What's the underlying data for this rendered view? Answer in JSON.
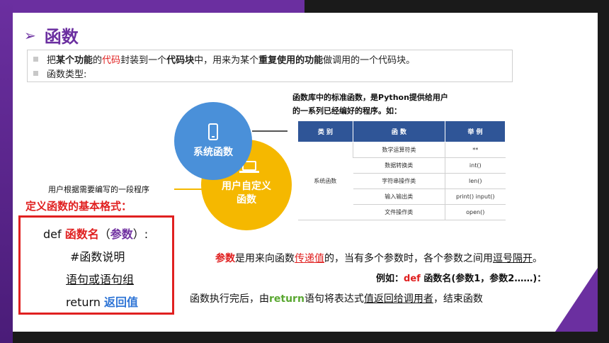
{
  "title": "函数",
  "bullets": {
    "line1": {
      "p1": "把",
      "p2": "某个功能",
      "p3": "的",
      "p4": "代码",
      "p5": "封装到一个",
      "p6": "代码块",
      "p7": "中，用来为某个",
      "p8": "重复使用的功能",
      "p9": "做调用的一个代码块。"
    },
    "line2": "函数类型:"
  },
  "library_description": {
    "line1": "函数库中的标准函数，是Python提供给用户",
    "line2": "的一系列已经编好的程序。如："
  },
  "circles": {
    "system": "系统函数",
    "user_line1": "用户自定义",
    "user_line2": "函数"
  },
  "user_description": "用户根据需要编写的一段程序",
  "table": {
    "headers": [
      "类 别",
      "函 数",
      "举 例"
    ],
    "category": "系统函数",
    "rows": [
      {
        "func": "数学运算符类",
        "example": "**"
      },
      {
        "func": "数据转换类",
        "example": "int()"
      },
      {
        "func": "字符串操作类",
        "example": "len()"
      },
      {
        "func": "输入输出类",
        "example": "print()  input()"
      },
      {
        "func": "文件操作类",
        "example": "open()"
      }
    ]
  },
  "definition": {
    "title": "定义函数的基本格式：",
    "def_kw": "def ",
    "func_name": "函数名",
    "paren_open": "（",
    "params": "参数",
    "paren_close": "）:",
    "comment": "#函数说明",
    "statements": "语句或语句组",
    "return_kw": "return ",
    "return_value": "返回值"
  },
  "param_explanation": {
    "p1": "参数",
    "p2": "是用来向函数",
    "p3": "传递值",
    "p4": "的，当有多个参数时，各个参数之间用",
    "p5": "逗号隔开",
    "p6": "。"
  },
  "example": {
    "prefix": "例如：",
    "kw": "def",
    "rest": " 函数名(参数1，参数2……)："
  },
  "return_explanation": {
    "p1": "函数执行完后，由",
    "p2": "return",
    "p3": "语句将表达式",
    "p4": "值返回给调用者",
    "p5": "，结束函数"
  },
  "colors": {
    "accent_purple": "#6b2fa0",
    "red": "#e02020",
    "blue_circle": "#4a90d9",
    "yellow_circle": "#f5b800",
    "table_header": "#2f5597",
    "green": "#5aa832"
  }
}
